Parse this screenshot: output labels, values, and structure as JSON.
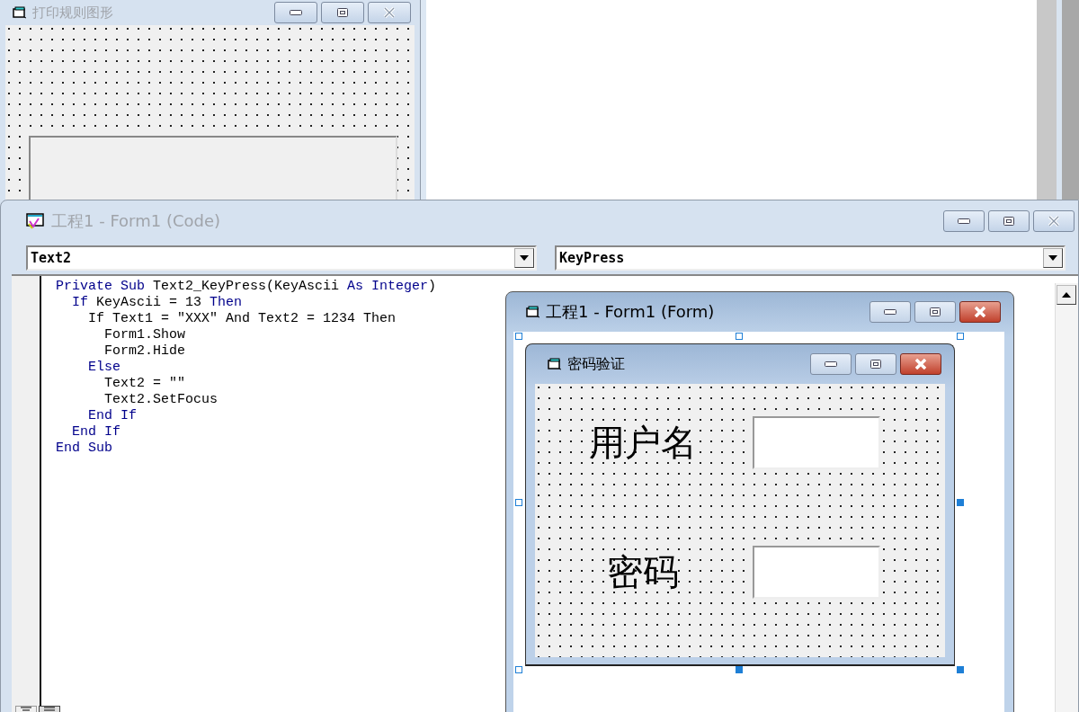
{
  "print_form": {
    "title": "打印规则图形",
    "active": false
  },
  "code_window": {
    "title": "工程1 - Form1 (Code)",
    "active": false,
    "object_combo": "Text2",
    "procedure_combo": "KeyPress",
    "lines": [
      {
        "tokens": [
          {
            "kind": "keyword",
            "text": "Private Sub"
          },
          {
            "kind": "plain",
            "text": " Text2_KeyPress(KeyAscii "
          },
          {
            "kind": "keyword",
            "text": "As Integer"
          },
          {
            "kind": "plain",
            "text": ")"
          }
        ],
        "children": [
          {
            "tokens": [
              {
                "kind": "keyword",
                "text": "If"
              },
              {
                "kind": "plain",
                "text": " KeyAscii = 13 "
              },
              {
                "kind": "keyword",
                "text": "Then"
              }
            ],
            "children": [
              {
                "tokens": [
                  {
                    "kind": "plain",
                    "text": "If Text1 = \"XXX\" And Text2 = 1234 Then"
                  }
                ],
                "children": [
                  {
                    "tokens": [
                      {
                        "kind": "plain",
                        "text": "Form1.Show"
                      }
                    ]
                  },
                  {
                    "tokens": [
                      {
                        "kind": "plain",
                        "text": "Form2.Hide"
                      }
                    ]
                  }
                ]
              },
              {
                "tokens": [
                  {
                    "kind": "keyword",
                    "text": "Else"
                  }
                ],
                "children": [
                  {
                    "tokens": [
                      {
                        "kind": "plain",
                        "text": "Text2 = \"\""
                      }
                    ]
                  },
                  {
                    "tokens": [
                      {
                        "kind": "plain",
                        "text": "Text2.SetFocus"
                      }
                    ]
                  }
                ]
              },
              {
                "tokens": [
                  {
                    "kind": "keyword",
                    "text": "End If"
                  }
                ]
              }
            ]
          },
          {
            "tokens": [
              {
                "kind": "keyword",
                "text": "End If"
              }
            ]
          }
        ]
      },
      {
        "tokens": [
          {
            "kind": "keyword",
            "text": "End Sub"
          }
        ]
      }
    ]
  },
  "form_designer": {
    "title": "工程1 - Form1 (Form)",
    "active": true,
    "form": {
      "title": "密码验证",
      "active": true,
      "fields": [
        {
          "label": "用户名"
        },
        {
          "label": "密码"
        }
      ]
    }
  }
}
